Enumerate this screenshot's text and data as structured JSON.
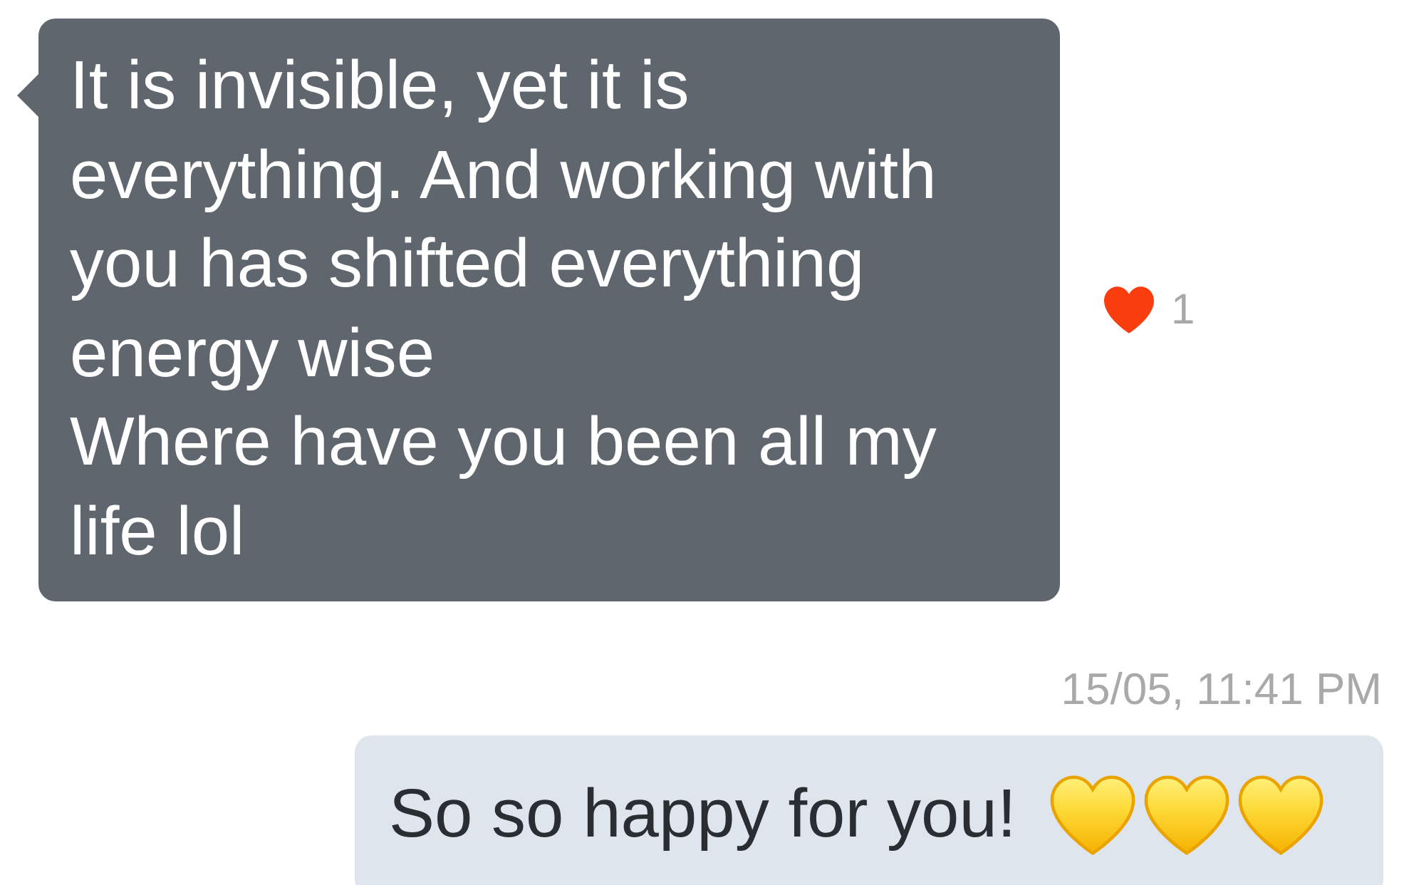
{
  "messages": [
    {
      "kind": "received",
      "text": "It is invisible, yet it is everything. And working with you has shifted everything energy wise\nWhere have you been all my life lol",
      "reaction": {
        "kind": "heart",
        "count": "1"
      }
    },
    {
      "kind": "timestamp",
      "text": "15/05, 11:41 PM"
    },
    {
      "kind": "sent",
      "text": "So so happy for you!",
      "emoji": [
        {
          "kind": "heart"
        },
        {
          "kind": "heart"
        },
        {
          "kind": "heart"
        }
      ]
    }
  ]
}
